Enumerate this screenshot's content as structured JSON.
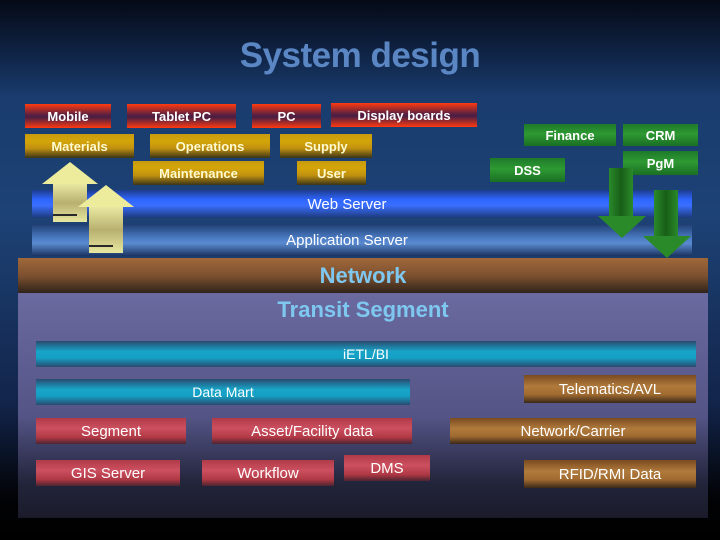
{
  "title": "System design",
  "devices": [
    "Mobile",
    "Tablet PC",
    "PC",
    "Display boards"
  ],
  "modules": {
    "row1": [
      "Materials",
      "Operations",
      "Supply"
    ],
    "row2": [
      "Maintenance",
      "User"
    ]
  },
  "business": {
    "finance": "Finance",
    "crm": "CRM",
    "dss": "DSS",
    "pgm": "PgM"
  },
  "layers": {
    "web_server": "Web Server",
    "application_server": "Application Server",
    "network": "Network",
    "transit_segment": "Transit Segment",
    "ietl": "iETL/BI",
    "data_mart": "Data  Mart"
  },
  "data_sources": {
    "segment": "Segment",
    "asset": "Asset/Facility data",
    "gis": "GIS Server",
    "workflow": "Workflow",
    "dms": "DMS",
    "telematics": "Telematics/AVL",
    "network_carrier": "Network/Carrier",
    "rfid": "RFID/RMI Data"
  },
  "colors": {
    "title": "#5a86c4",
    "device_box": "#ff3a10",
    "module_box": "#c79a10",
    "business_box": "#2e9a32",
    "web_server_band": "#2f66ff",
    "network_band": "#a0683a",
    "transit_panel": "#6a6aa0",
    "data_mart": "#18a4c8",
    "internal_source": "#cc5060",
    "external_source": "#b07a3c"
  }
}
